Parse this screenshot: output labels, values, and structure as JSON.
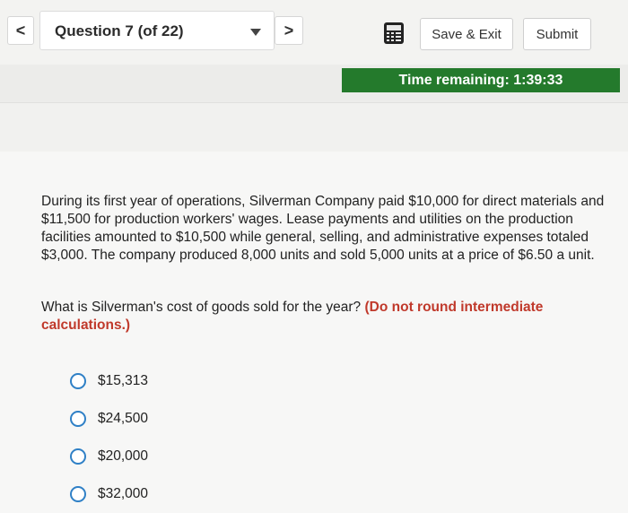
{
  "header": {
    "prev_glyph": "<",
    "next_glyph": ">",
    "question_selector": "Question 7 (of 22)",
    "save_exit_label": "Save & Exit",
    "submit_label": "Submit"
  },
  "timer": {
    "text": "Time remaining: 1:39:33"
  },
  "question": {
    "paragraph": "During its first year of operations, Silverman Company paid $10,000 for direct materials and $11,500 for production workers' wages. Lease payments and utilities on the production facilities amounted to $10,500 while general, selling, and administrative expenses totaled $3,000. The company produced 8,000 units and sold 5,000 units at a price of $6.50 a unit.",
    "prompt": "What is Silverman's cost of goods sold for the year?",
    "hint": "(Do not round intermediate calculations.)"
  },
  "options": [
    {
      "label": "$15,313"
    },
    {
      "label": "$24,500"
    },
    {
      "label": "$20,000"
    },
    {
      "label": "$32,000"
    }
  ],
  "colors": {
    "timer_bg": "#247a2c",
    "hint_text": "#c0392b",
    "radio_border": "#2f80c6"
  }
}
